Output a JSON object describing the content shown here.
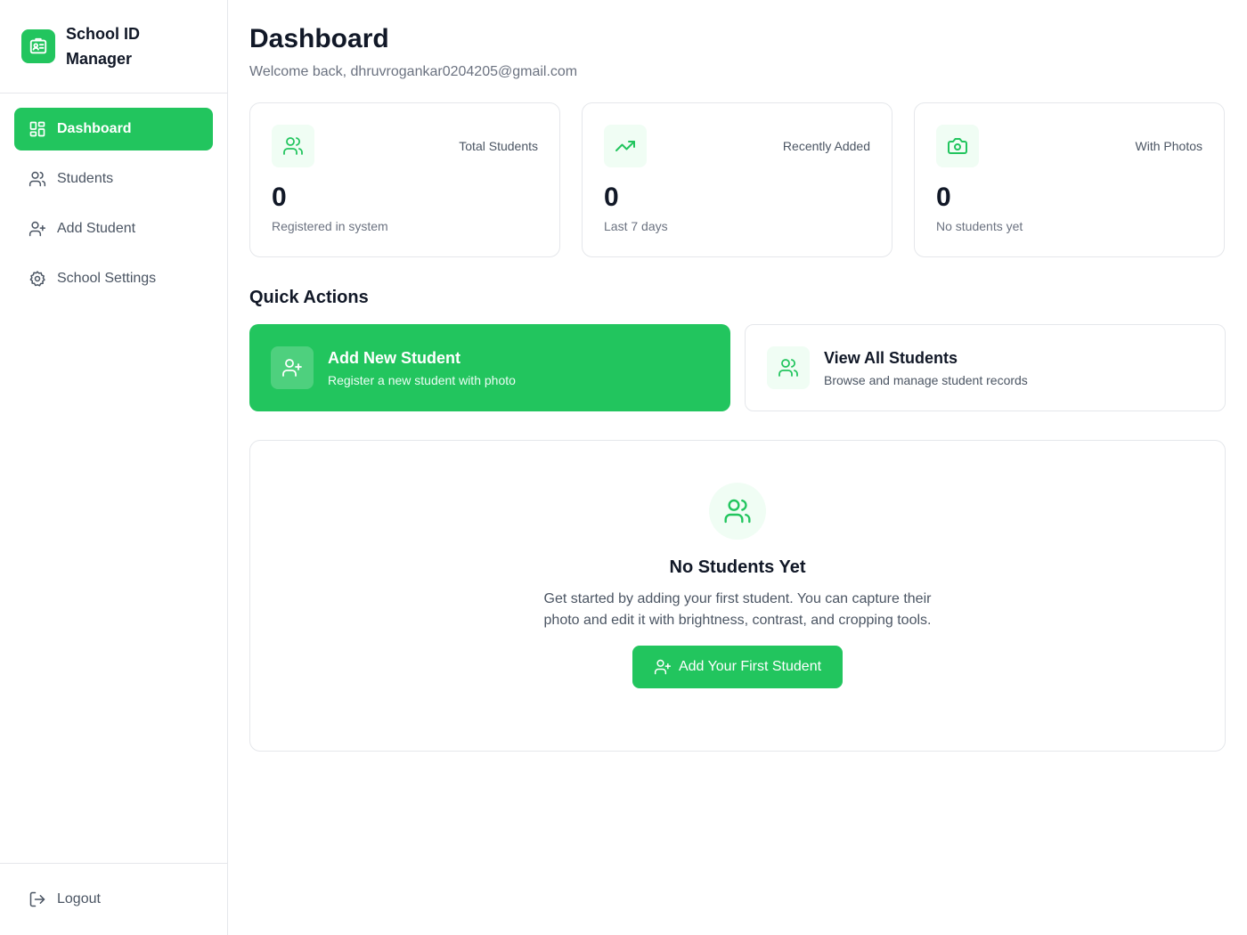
{
  "brand": {
    "title": "School ID Manager"
  },
  "sidebar": {
    "items": [
      {
        "label": "Dashboard",
        "icon": "dashboard-grid-icon",
        "active": true
      },
      {
        "label": "Students",
        "icon": "users-icon",
        "active": false
      },
      {
        "label": "Add Student",
        "icon": "user-plus-icon",
        "active": false
      },
      {
        "label": "School Settings",
        "icon": "gear-icon",
        "active": false
      }
    ],
    "logout_label": "Logout"
  },
  "header": {
    "title": "Dashboard",
    "welcome": "Welcome back, dhruvrogankar0204205@gmail.com"
  },
  "stats": [
    {
      "label": "Total Students",
      "value": "0",
      "sub": "Registered in system",
      "icon": "users-icon"
    },
    {
      "label": "Recently Added",
      "value": "0",
      "sub": "Last 7 days",
      "icon": "trending-up-icon"
    },
    {
      "label": "With Photos",
      "value": "0",
      "sub": "No students yet",
      "icon": "camera-icon"
    }
  ],
  "quick_actions": {
    "title": "Quick Actions",
    "items": [
      {
        "title": "Add New Student",
        "desc": "Register a new student with photo",
        "icon": "user-plus-icon"
      },
      {
        "title": "View All Students",
        "desc": "Browse and manage student records",
        "icon": "users-icon"
      }
    ]
  },
  "empty_state": {
    "title": "No Students Yet",
    "text": "Get started by adding your first student. You can capture their photo and edit it with brightness, contrast, and cropping tools.",
    "button_label": "Add Your First Student"
  },
  "colors": {
    "accent": "#22c55e",
    "accent_light": "#f0fdf4",
    "border": "#e5e7eb",
    "muted": "#6b7280"
  }
}
